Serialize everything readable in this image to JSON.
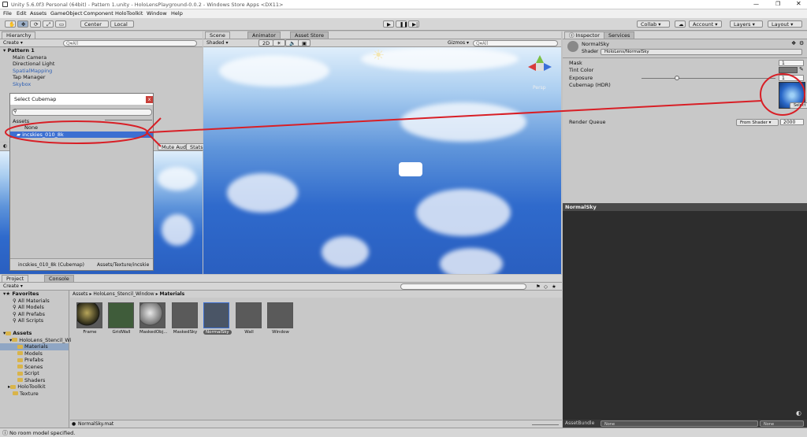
{
  "window": {
    "title": "Unity 5.6.0f3 Personal (64bit) - Pattern 1.unity - HoloLensPlayground-0.0.2 - Windows Store Apps <DX11>"
  },
  "menu": [
    "File",
    "Edit",
    "Assets",
    "GameObject",
    "Component",
    "HoloToolkit",
    "Window",
    "Help"
  ],
  "toolbar": {
    "center": "Center",
    "local": "Local",
    "collab": "Collab ▾",
    "account": "Account ▾",
    "layers": "Layers ▾",
    "layout": "Layout ▾"
  },
  "hierarchy": {
    "tab": "Hierarchy",
    "create": "Create ▾",
    "search": "Q▾All",
    "scene": "Pattern 1",
    "items": [
      {
        "label": "Main Camera",
        "blue": false
      },
      {
        "label": "Directional Light",
        "blue": false
      },
      {
        "label": "SpatialMapping",
        "blue": true
      },
      {
        "label": "Tap Manager",
        "blue": false
      },
      {
        "label": "Skybox",
        "blue": true
      }
    ]
  },
  "cubemap_dialog": {
    "title": "Select Cubemap",
    "section": "Assets",
    "none": "None",
    "selected": "incskies_010_8k",
    "footer_name": "incskies_010_8k (Cubemap)",
    "footer_path": "Assets/Texture/incskie"
  },
  "game_bar": {
    "mute": "Mute Audio",
    "stats": "Stats"
  },
  "scene": {
    "tabs": [
      "Scene",
      "Animator",
      "Asset Store"
    ],
    "shaded": "Shaded ▾",
    "mode2d": "2D",
    "gizmos": "Gizmos ▾",
    "search": "Q▾All",
    "persp": "Persp"
  },
  "inspector": {
    "tabs": [
      "Inspector",
      "Services"
    ],
    "material": "NormalSky",
    "shader_label": "Shader",
    "shader_value": "HoloLens/NormalSky",
    "mask_label": "Mask",
    "mask_value": "1",
    "tint_label": "Tint Color",
    "exposure_label": "Exposure",
    "exposure_value": "1",
    "cubemap_label": "Cubemap (HDR)",
    "select": "Select",
    "render_queue_label": "Render Queue",
    "render_queue_mode": "From Shader ▾",
    "render_queue_value": "2000",
    "preview_title": "NormalSky",
    "assetbundle_label": "AssetBundle",
    "assetbundle_a": "None",
    "assetbundle_b": "None"
  },
  "project": {
    "tabs": [
      "Project",
      "Console"
    ],
    "create": "Create ▾",
    "favorites": "Favorites",
    "fav_items": [
      "All Materials",
      "All Models",
      "All Prefabs",
      "All Scripts"
    ],
    "assets": "Assets",
    "tree": [
      "HoloLens_Stencil_Wi",
      "Materials",
      "Models",
      "Prefabs",
      "Scenes",
      "Script",
      "Shaders"
    ],
    "tree2": [
      "HoloToolkit",
      "Texture"
    ],
    "breadcrumb": [
      "Assets",
      "HoloLens_Stencil_Window",
      "Materials"
    ],
    "items": [
      "Frame",
      "GridWall",
      "MaskedObj...",
      "MaskedSky",
      "NormalSky",
      "Wall",
      "Window"
    ],
    "selected_file": "NormalSky.mat"
  },
  "status": {
    "text": "No room model specified."
  },
  "colors": {
    "selection": "#3d6fd1",
    "annotation": "#d81f26"
  }
}
